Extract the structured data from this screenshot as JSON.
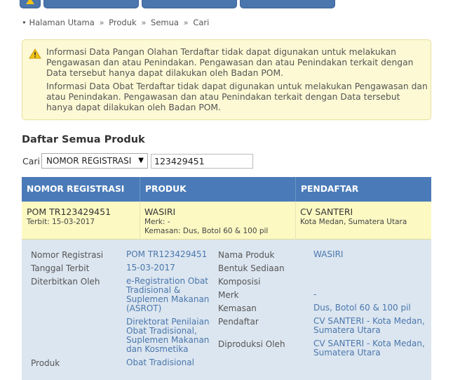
{
  "breadcrumb": {
    "items": [
      "Halaman Utama",
      "Produk",
      "Semua",
      "Cari"
    ],
    "separator": "»"
  },
  "notice": {
    "icon": "warning-icon",
    "message1": "Informasi Data Pangan Olahan Terdaftar tidak dapat digunakan untuk melakukan Pengawasan dan atau Penindakan. Pengawasan dan atau Penindakan terkait dengan Data tersebut hanya dapat dilakukan oleh Badan POM.",
    "message2": "Informasi Data Obat Terdaftar tidak dapat digunakan untuk melakukan Pengawasan dan atau Penindakan. Pengawasan dan atau Penindakan terkait dengan Data tersebut hanya dapat dilakukan oleh Badan POM."
  },
  "section_title": "Daftar Semua Produk",
  "search": {
    "label": "Cari",
    "select_value": "NOMOR REGISTRASI",
    "input_value": "123429451"
  },
  "table": {
    "headers": [
      "NOMOR REGISTRASI",
      "PRODUK",
      "PENDAFTAR"
    ],
    "row": {
      "nomor": "POM TR123429451",
      "terbit": "Terbit: 15-03-2017",
      "produk": "WASIRI",
      "merk": "Merk: -",
      "kemasan": "Kemasan: Dus, Botol 60 & 100 pil",
      "pendaftar": "CV SANTERI",
      "lokasi": "Kota Medan, Sumatera Utara"
    }
  },
  "detail": {
    "left": [
      {
        "label": "Nomor Registrasi",
        "value": "POM TR123429451"
      },
      {
        "label": "Tanggal Terbit",
        "value": "15-03-2017"
      },
      {
        "label": "Diterbitkan Oleh",
        "value": "e-Registration Obat Tradisional & Suplemen Makanan (ASROT)"
      },
      {
        "label": "",
        "value": "Direktorat Penilaian Obat Tradisional, Suplemen Makanan dan Kosmetika"
      },
      {
        "label": "Produk",
        "value": "Obat Tradisional"
      }
    ],
    "right": [
      {
        "label": "Nama Produk",
        "value": "WASIRI"
      },
      {
        "label": "Bentuk Sediaan",
        "value": ""
      },
      {
        "label": "Komposisi",
        "value": ""
      },
      {
        "label": "Merk",
        "value": "-"
      },
      {
        "label": "Kemasan",
        "value": "Dus, Botol 60 & 100 pil"
      },
      {
        "label": "Pendaftar",
        "value": "CV SANTERI - Kota Medan, Sumatera Utara"
      },
      {
        "label": "Diproduksi Oleh",
        "value": "CV SANTERI - Kota Medan, Sumatera Utara"
      }
    ]
  },
  "colors": {
    "header_blue": "#4a7bb8",
    "notice_bg": "#fcf9d4",
    "row_highlight": "#fcf9c3",
    "detail_bg": "#dce6f0",
    "link_blue": "#4a77ad"
  }
}
